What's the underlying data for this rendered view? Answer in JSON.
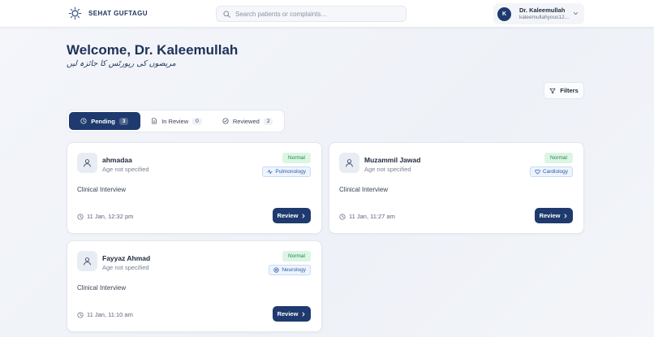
{
  "app": {
    "name": "SEHAT GUFTAGU"
  },
  "search": {
    "placeholder": "Search patients or complaints..."
  },
  "user": {
    "initial": "K",
    "name": "Dr. Kaleemullah",
    "email": "kaleemullahyous12..."
  },
  "welcome": {
    "title": "Welcome, Dr. Kaleemullah",
    "subtitle": "مریضوں کی رپورٹس کا جائزہ لیں"
  },
  "filters": {
    "label": "Filters"
  },
  "tabs": [
    {
      "label": "Pending",
      "count": "3",
      "icon": "clock-icon",
      "active": true
    },
    {
      "label": "In Review",
      "count": "0",
      "icon": "document-icon",
      "active": false
    },
    {
      "label": "Reviewed",
      "count": "2",
      "icon": "check-circle-icon",
      "active": false
    }
  ],
  "cards": [
    {
      "name": "ahmadaa",
      "age": "Age not specified",
      "status": "Normal",
      "department": "Pulmonology",
      "department_icon": "pulse-icon",
      "type": "Clinical Interview",
      "time": "11 Jan, 12:32 pm",
      "action": "Review"
    },
    {
      "name": "Muzammil Jawad",
      "age": "Age not specified",
      "status": "Normal",
      "department": "Cardiology",
      "department_icon": "heart-icon",
      "type": "Clinical Interview",
      "time": "11 Jan, 11:27 am",
      "action": "Review"
    },
    {
      "name": "Fayyaz Ahmad",
      "age": "Age not specified",
      "status": "Normal",
      "department": "Neurology",
      "department_icon": "target-icon",
      "type": "Clinical Interview",
      "time": "11 Jan, 11:10 am",
      "action": "Review"
    }
  ],
  "colors": {
    "primary": "#1e3a6e",
    "status_normal_bg": "#dcf5e4",
    "status_normal_text": "#23884a",
    "dept_text": "#2a5bab"
  }
}
